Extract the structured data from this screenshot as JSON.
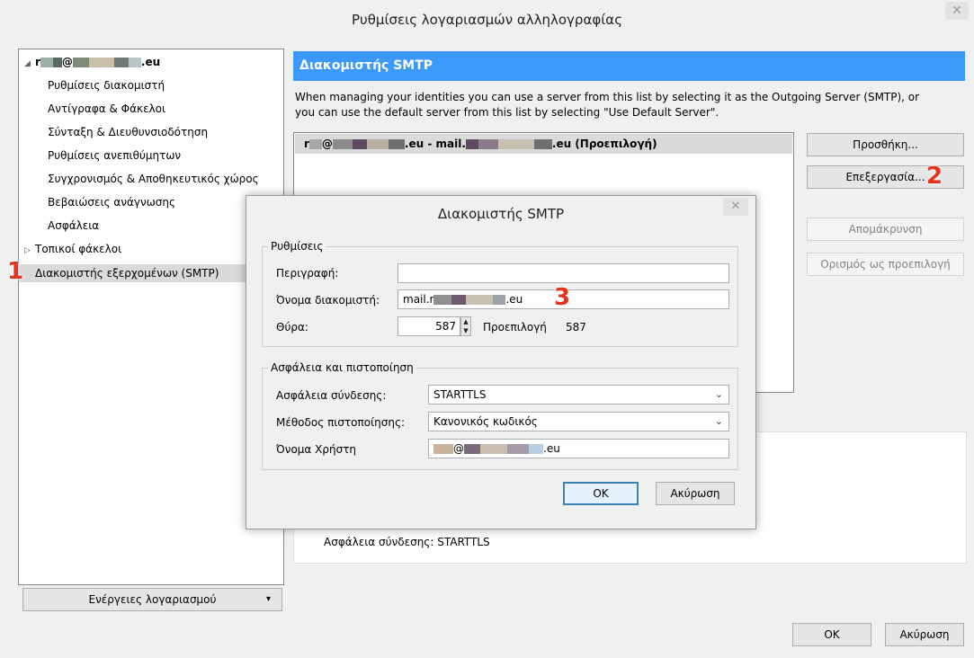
{
  "window": {
    "title": "Ρυθμίσεις λογαριασμών αλληλογραφίας",
    "close_glyph": "✕"
  },
  "tree": {
    "account": {
      "prefix": "r",
      "mid": "@",
      "suffix": ".eu"
    },
    "children": [
      "Ρυθμίσεις διακομιστή",
      "Αντίγραφα & Φάκελοι",
      "Σύνταξη & Διευθυνσιοδότηση",
      "Ρυθμίσεις ανεπιθύμητων",
      "Συγχρονισμός & Αποθηκευτικός χώρος",
      "Βεβαιώσεις ανάγνωσης",
      "Ασφάλεια"
    ],
    "local_folders": "Τοπικοί φάκελοι",
    "smtp_item": "Διακομιστής εξερχομένων (SMTP)",
    "badge": "1"
  },
  "account_actions": {
    "label": "Ενέργειες λογαριασμού",
    "caret": "▾"
  },
  "pane": {
    "header": "Διακομιστής SMTP",
    "desc_line1": "When managing your identities you can use a server from this list by selecting it as the Outgoing Server (SMTP), or",
    "desc_line2": "you can use the default server from this list by selecting \"Use Default Server\".",
    "server_row": {
      "a": "r",
      "b": "@",
      "c": ".eu - mail.",
      "d": ".eu (Προεπιλογή)"
    }
  },
  "side_buttons": {
    "add": "Προσθήκη...",
    "edit": "Επεξεργασία...",
    "edit_badge": "2",
    "remove": "Απομάκρυνση",
    "set_default": "Ορισμός ως προεπιλογή"
  },
  "details": {
    "security_label": "Ασφάλεια σύνδεσης:",
    "security_value": "STARTTLS"
  },
  "main_buttons": {
    "ok": "OK",
    "cancel": "Ακύρωση"
  },
  "dialog": {
    "title": "Διακομιστής SMTP",
    "close_glyph": "✕",
    "settings_group": "Ρυθμίσεις",
    "description_label": "Περιγραφή:",
    "description_value": "",
    "server_name_label": "Όνομα διακομιστή:",
    "server_name_prefix": "mail.r",
    "server_name_suffix": ".eu",
    "server_badge": "3",
    "port_label": "Θύρα:",
    "port_value": "587",
    "default_label": "Προεπιλογή",
    "default_value": "587",
    "security_group": "Ασφάλεια και πιστοποίηση",
    "conn_security_label": "Ασφάλεια σύνδεσης:",
    "conn_security_value": "STARTTLS",
    "auth_method_label": "Μέθοδος πιστοποίησης:",
    "auth_method_value": "Κανονικός κωδικός",
    "username_label": "Όνομα Χρήστη",
    "username_mid": "@",
    "username_suffix": ".eu",
    "ok": "OK",
    "cancel": "Ακύρωση"
  },
  "colors": {
    "header_blue": "#3b99fc",
    "badge_red": "#e8331c",
    "selection_gray": "#dadada"
  }
}
